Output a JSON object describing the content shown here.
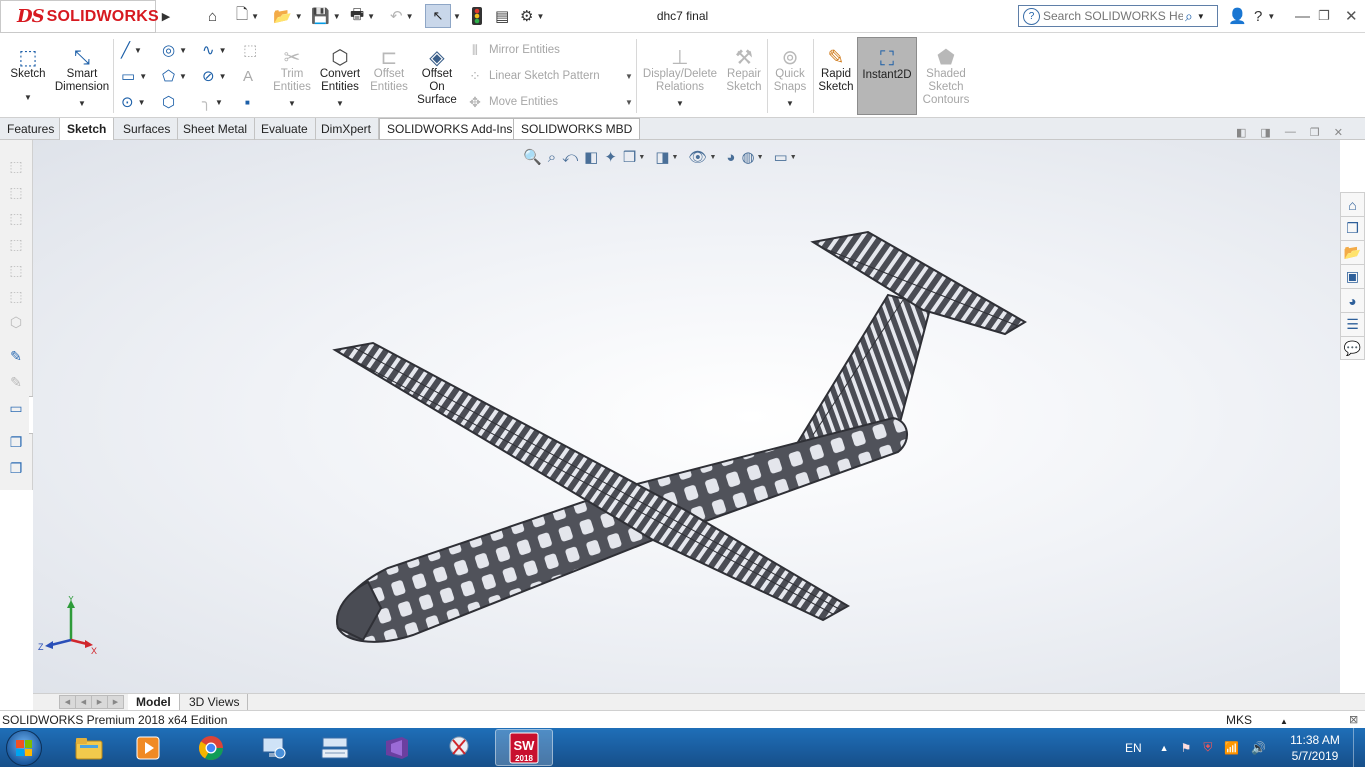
{
  "app": {
    "logo_prefix": "DS",
    "logo_text": "SOLIDWORKS",
    "document_title": "dhc7 final",
    "search_placeholder": "Search SOLIDWORKS Help"
  },
  "command_manager": {
    "sketch": "Sketch",
    "smart_dimension": [
      "Smart",
      "Dimension"
    ],
    "trim_entities": [
      "Trim",
      "Entities"
    ],
    "convert_entities": [
      "Convert",
      "Entities"
    ],
    "offset_entities": [
      "Offset",
      "Entities"
    ],
    "offset_on_surface": [
      "Offset",
      "On",
      "Surface"
    ],
    "mirror_entities": "Mirror Entities",
    "linear_sketch_pattern": "Linear Sketch Pattern",
    "move_entities": "Move Entities",
    "display_delete_relations": [
      "Display/Delete",
      "Relations"
    ],
    "repair_sketch": [
      "Repair",
      "Sketch"
    ],
    "quick_snaps": [
      "Quick",
      "Snaps"
    ],
    "rapid_sketch": [
      "Rapid",
      "Sketch"
    ],
    "instant2d": "Instant2D",
    "shaded_sketch_contours": [
      "Shaded",
      "Sketch",
      "Contours"
    ]
  },
  "tabs": [
    "Features",
    "Sketch",
    "Surfaces",
    "Sheet Metal",
    "Evaluate",
    "DimXpert",
    "SOLIDWORKS Add-Ins",
    "SOLIDWORKS MBD"
  ],
  "active_tab": "Sketch",
  "triad": {
    "x": "X",
    "y": "Y",
    "z": "Z"
  },
  "model_tabs": [
    "Model",
    "3D Views"
  ],
  "status": {
    "edition": "SOLIDWORKS Premium 2018 x64 Edition",
    "units": "MKS"
  },
  "taskbar": {
    "sw_badge": "SW",
    "sw_version": "2018",
    "language": "EN",
    "time": "11:38 AM",
    "date": "5/7/2019"
  },
  "colors": {
    "brand_red": "#d71920",
    "taskbar_blue": "#1a5d9f",
    "icon_blue": "#1c5fa8",
    "model_gray": "#4a4c54"
  }
}
